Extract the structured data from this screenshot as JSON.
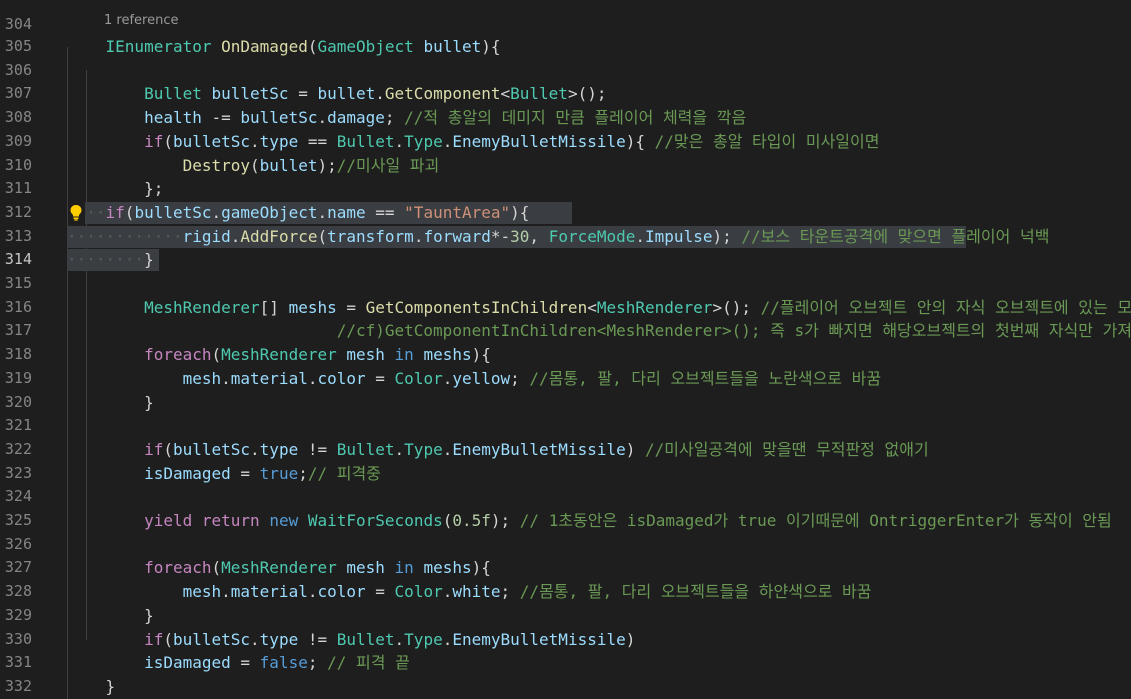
{
  "editor": {
    "partial_top_line_number": "304",
    "codelens_label": "1 reference",
    "current_line_number": "314"
  },
  "lines": [
    {
      "num": "305",
      "tokens": [
        [
          "t",
          "IEnumerator"
        ],
        [
          "p",
          " "
        ],
        [
          "f",
          "OnDamaged"
        ],
        [
          "p",
          "("
        ],
        [
          "t",
          "GameObject"
        ],
        [
          "p",
          " "
        ],
        [
          "v",
          "bullet"
        ],
        [
          "p",
          "){"
        ]
      ]
    },
    {
      "num": "306",
      "tokens": []
    },
    {
      "num": "307",
      "tokens": [
        [
          "t",
          "Bullet"
        ],
        [
          "p",
          " "
        ],
        [
          "v",
          "bulletSc"
        ],
        [
          "p",
          " = "
        ],
        [
          "v",
          "bullet"
        ],
        [
          "p",
          "."
        ],
        [
          "f",
          "GetComponent"
        ],
        [
          "p",
          "<"
        ],
        [
          "t",
          "Bullet"
        ],
        [
          "p",
          ">();"
        ]
      ]
    },
    {
      "num": "308",
      "tokens": [
        [
          "v",
          "health"
        ],
        [
          "p",
          " -= "
        ],
        [
          "v",
          "bulletSc"
        ],
        [
          "p",
          "."
        ],
        [
          "v",
          "damage"
        ],
        [
          "p",
          "; "
        ],
        [
          "c",
          "//적 총알의 데미지 만큼 플레이어 체력을 깍음"
        ]
      ]
    },
    {
      "num": "309",
      "tokens": [
        [
          "k",
          "if"
        ],
        [
          "p",
          "("
        ],
        [
          "v",
          "bulletSc"
        ],
        [
          "p",
          "."
        ],
        [
          "v",
          "type"
        ],
        [
          "p",
          " == "
        ],
        [
          "t",
          "Bullet"
        ],
        [
          "p",
          "."
        ],
        [
          "t",
          "Type"
        ],
        [
          "p",
          "."
        ],
        [
          "v",
          "EnemyBulletMissile"
        ],
        [
          "p",
          "){ "
        ],
        [
          "c",
          "//맞은 총알 타입이 미사일이면"
        ]
      ]
    },
    {
      "num": "310",
      "tokens": [
        [
          "f",
          "Destroy"
        ],
        [
          "p",
          "("
        ],
        [
          "v",
          "bullet"
        ],
        [
          "p",
          ");"
        ],
        [
          "c",
          "//미사일 파괴"
        ]
      ]
    },
    {
      "num": "311",
      "tokens": [
        [
          "p",
          "};"
        ]
      ]
    },
    {
      "num": "312",
      "tokens": [
        [
          "k",
          "if"
        ],
        [
          "p",
          "("
        ],
        [
          "v",
          "bulletSc"
        ],
        [
          "p",
          "."
        ],
        [
          "v",
          "gameObject"
        ],
        [
          "p",
          "."
        ],
        [
          "v",
          "name"
        ],
        [
          "p",
          " == "
        ],
        [
          "s",
          "\"TauntArea\""
        ],
        [
          "p",
          "){"
        ]
      ]
    },
    {
      "num": "313",
      "tokens": [
        [
          "v",
          "rigid"
        ],
        [
          "p",
          "."
        ],
        [
          "f",
          "AddForce"
        ],
        [
          "p",
          "("
        ],
        [
          "v",
          "transform"
        ],
        [
          "p",
          "."
        ],
        [
          "v",
          "forward"
        ],
        [
          "p",
          "*-"
        ],
        [
          "n",
          "30"
        ],
        [
          "p",
          ", "
        ],
        [
          "t",
          "ForceMode"
        ],
        [
          "p",
          "."
        ],
        [
          "v",
          "Impulse"
        ],
        [
          "p",
          "); "
        ],
        [
          "c",
          "//보스 타운트공격에 맞으면 플레이어 넉백"
        ]
      ]
    },
    {
      "num": "314",
      "tokens": [
        [
          "p",
          "}"
        ]
      ]
    },
    {
      "num": "315",
      "tokens": []
    },
    {
      "num": "316",
      "tokens": [
        [
          "t",
          "MeshRenderer"
        ],
        [
          "p",
          "[] "
        ],
        [
          "v",
          "meshs"
        ],
        [
          "p",
          " = "
        ],
        [
          "f",
          "GetComponentsInChildren"
        ],
        [
          "p",
          "<"
        ],
        [
          "t",
          "MeshRenderer"
        ],
        [
          "p",
          ">(); "
        ],
        [
          "c",
          "//플레이어 오브젝트 안의 자식 오브젝트에 있는 모든 MeshRenderer를 가져옴"
        ]
      ]
    },
    {
      "num": "317",
      "tokens": [
        [
          "c",
          "//cf)GetComponentInChildren<MeshRenderer>(); 즉 s가 빠지면 해당오브젝트의 첫번째 자식만 가져옴"
        ]
      ]
    },
    {
      "num": "318",
      "tokens": [
        [
          "k",
          "foreach"
        ],
        [
          "p",
          "("
        ],
        [
          "t",
          "MeshRenderer"
        ],
        [
          "p",
          " "
        ],
        [
          "v",
          "mesh"
        ],
        [
          "p",
          " "
        ],
        [
          "b",
          "in"
        ],
        [
          "p",
          " "
        ],
        [
          "v",
          "meshs"
        ],
        [
          "p",
          "){"
        ]
      ]
    },
    {
      "num": "319",
      "tokens": [
        [
          "v",
          "mesh"
        ],
        [
          "p",
          "."
        ],
        [
          "v",
          "material"
        ],
        [
          "p",
          "."
        ],
        [
          "v",
          "color"
        ],
        [
          "p",
          " = "
        ],
        [
          "t",
          "Color"
        ],
        [
          "p",
          "."
        ],
        [
          "v",
          "yellow"
        ],
        [
          "p",
          "; "
        ],
        [
          "c",
          "//몸통, 팔, 다리 오브젝트들을 노란색으로 바꿈"
        ]
      ]
    },
    {
      "num": "320",
      "tokens": [
        [
          "p",
          "}"
        ]
      ]
    },
    {
      "num": "321",
      "tokens": []
    },
    {
      "num": "322",
      "tokens": [
        [
          "k",
          "if"
        ],
        [
          "p",
          "("
        ],
        [
          "v",
          "bulletSc"
        ],
        [
          "p",
          "."
        ],
        [
          "v",
          "type"
        ],
        [
          "p",
          " != "
        ],
        [
          "t",
          "Bullet"
        ],
        [
          "p",
          "."
        ],
        [
          "t",
          "Type"
        ],
        [
          "p",
          "."
        ],
        [
          "v",
          "EnemyBulletMissile"
        ],
        [
          "p",
          ") "
        ],
        [
          "c",
          "//미사일공격에 맞을땐 무적판정 없애기"
        ]
      ]
    },
    {
      "num": "323",
      "tokens": [
        [
          "v",
          "isDamaged"
        ],
        [
          "p",
          " = "
        ],
        [
          "b",
          "true"
        ],
        [
          "p",
          ";"
        ],
        [
          "c",
          "// 피격중"
        ]
      ]
    },
    {
      "num": "324",
      "tokens": []
    },
    {
      "num": "325",
      "tokens": [
        [
          "k",
          "yield"
        ],
        [
          "p",
          " "
        ],
        [
          "k",
          "return"
        ],
        [
          "p",
          " "
        ],
        [
          "b",
          "new"
        ],
        [
          "p",
          " "
        ],
        [
          "t",
          "WaitForSeconds"
        ],
        [
          "p",
          "("
        ],
        [
          "n",
          "0.5f"
        ],
        [
          "p",
          "); "
        ],
        [
          "c",
          "// 1초동안은 isDamaged가 true 이기때문에 OntriggerEnter가 동작이 안됨"
        ]
      ]
    },
    {
      "num": "326",
      "tokens": []
    },
    {
      "num": "327",
      "tokens": [
        [
          "k",
          "foreach"
        ],
        [
          "p",
          "("
        ],
        [
          "t",
          "MeshRenderer"
        ],
        [
          "p",
          " "
        ],
        [
          "v",
          "mesh"
        ],
        [
          "p",
          " "
        ],
        [
          "b",
          "in"
        ],
        [
          "p",
          " "
        ],
        [
          "v",
          "meshs"
        ],
        [
          "p",
          "){"
        ]
      ]
    },
    {
      "num": "328",
      "tokens": [
        [
          "v",
          "mesh"
        ],
        [
          "p",
          "."
        ],
        [
          "v",
          "material"
        ],
        [
          "p",
          "."
        ],
        [
          "v",
          "color"
        ],
        [
          "p",
          " = "
        ],
        [
          "t",
          "Color"
        ],
        [
          "p",
          "."
        ],
        [
          "v",
          "white"
        ],
        [
          "p",
          "; "
        ],
        [
          "c",
          "//몸통, 팔, 다리 오브젝트들을 하얀색으로 바꿈"
        ]
      ]
    },
    {
      "num": "329",
      "tokens": [
        [
          "p",
          "}"
        ]
      ]
    },
    {
      "num": "330",
      "tokens": [
        [
          "k",
          "if"
        ],
        [
          "p",
          "("
        ],
        [
          "v",
          "bulletSc"
        ],
        [
          "p",
          "."
        ],
        [
          "v",
          "type"
        ],
        [
          "p",
          " != "
        ],
        [
          "t",
          "Bullet"
        ],
        [
          "p",
          "."
        ],
        [
          "t",
          "Type"
        ],
        [
          "p",
          "."
        ],
        [
          "v",
          "EnemyBulletMissile"
        ],
        [
          "p",
          ")"
        ]
      ]
    },
    {
      "num": "331",
      "tokens": [
        [
          "v",
          "isDamaged"
        ],
        [
          "p",
          " = "
        ],
        [
          "b",
          "false"
        ],
        [
          "p",
          "; "
        ],
        [
          "c",
          "// 피격 끝"
        ]
      ]
    },
    {
      "num": "332",
      "tokens": [
        [
          "p",
          "}"
        ]
      ]
    }
  ],
  "colors": {
    "background": "#1e1e1e",
    "line_number": "#858585",
    "type": "#4ec9b0",
    "function": "#dcdcaa",
    "variable": "#9cdcfe",
    "control_keyword": "#c586c0",
    "keyword": "#569cd6",
    "string": "#ce9178",
    "number": "#b5cea8",
    "comment": "#6a9955",
    "selection": "#3a3d41"
  },
  "icons": {
    "gutter_action": "lightbulb-icon"
  }
}
